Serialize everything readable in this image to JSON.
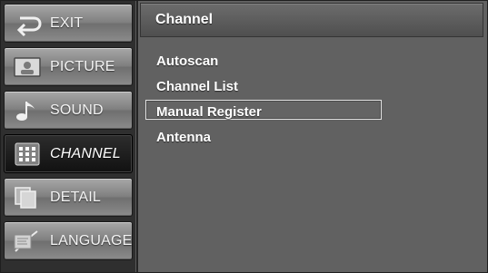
{
  "sidebar": {
    "items": [
      {
        "label": "EXIT",
        "icon": "exit-icon"
      },
      {
        "label": "PICTURE",
        "icon": "picture-icon"
      },
      {
        "label": "SOUND",
        "icon": "sound-icon"
      },
      {
        "label": "CHANNEL",
        "icon": "channel-icon",
        "active": true
      },
      {
        "label": "DETAIL",
        "icon": "detail-icon"
      },
      {
        "label": "LANGUAGE",
        "icon": "language-icon"
      }
    ]
  },
  "panel": {
    "title": "Channel",
    "options": [
      {
        "label": "Autoscan"
      },
      {
        "label": "Channel List"
      },
      {
        "label": "Manual Register",
        "selected": true
      },
      {
        "label": "Antenna"
      }
    ]
  },
  "colors": {
    "background": "#5a5a5a",
    "sidebar_background": "#2f2f2f",
    "highlight_border": "#e2e2e2",
    "active_background": "#111111",
    "text": "#ffffff"
  }
}
